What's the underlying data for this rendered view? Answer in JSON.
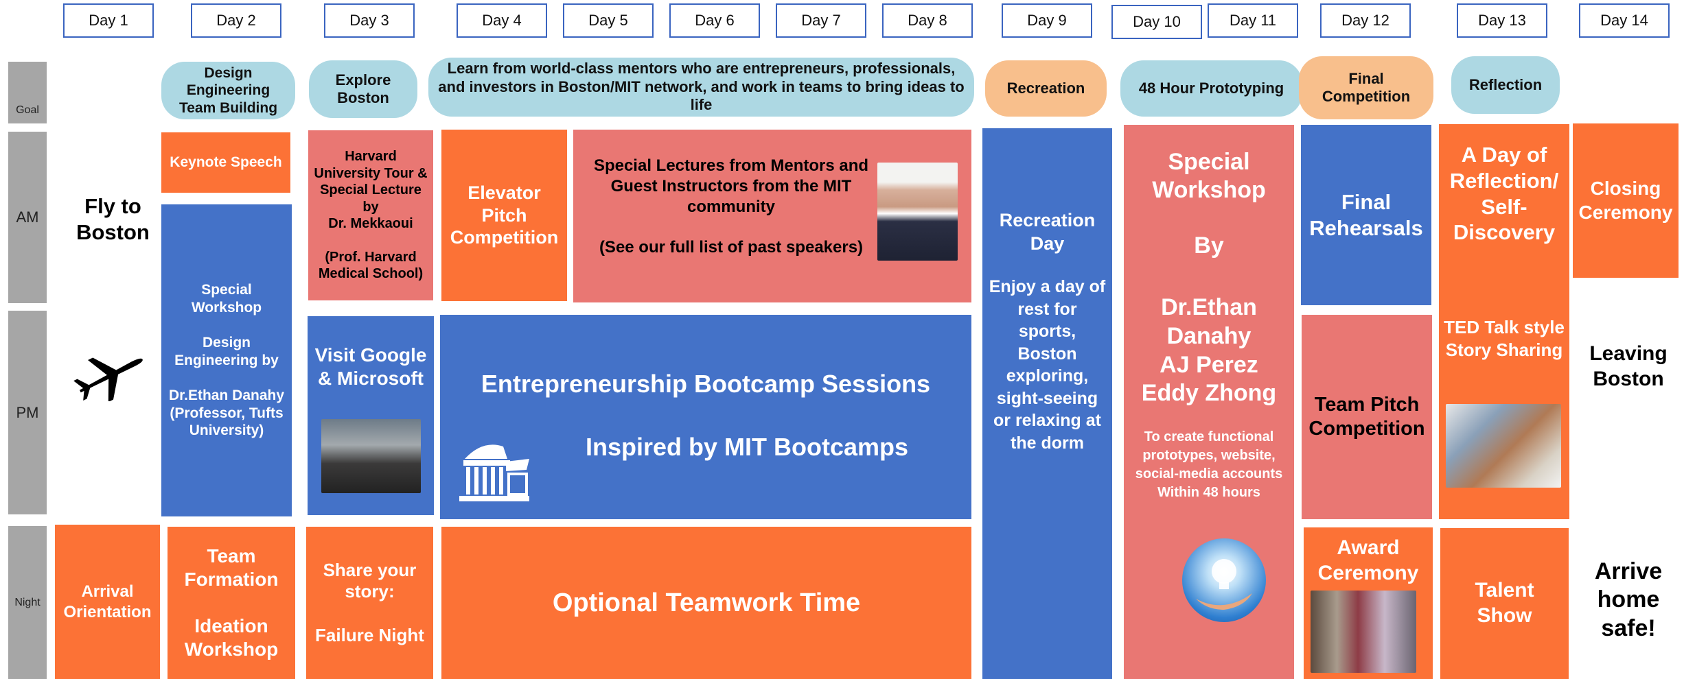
{
  "days": [
    "Day 1",
    "Day 2",
    "Day 3",
    "Day 4",
    "Day 5",
    "Day 6",
    "Day 7",
    "Day 8",
    "Day 9",
    "Day 10",
    "Day 11",
    "Day 12",
    "Day 13",
    "Day 14"
  ],
  "row_labels": {
    "goal": "Goal",
    "am": "AM",
    "pm": "PM",
    "night": "Night"
  },
  "goals": {
    "design_team": "Design Engineering Team Building",
    "explore": "Explore Boston",
    "learn": "Learn from world-class mentors who are entrepreneurs, professionals, and investors in Boston/MIT network, and work in teams to bring ideas to life",
    "recreation": "Recreation",
    "prototyping": "48 Hour Prototyping",
    "final": "Final Competition",
    "reflection": "Reflection"
  },
  "blocks": {
    "fly_to_boston": "Fly to Boston",
    "keynote": "Keynote Speech",
    "special_workshop_design": "Special Workshop\n\nDesign Engineering by\n\nDr.Ethan Danahy (Professor, Tufts University)",
    "harvard_tour": "Harvard University Tour &\nSpecial Lecture by\nDr. Mekkaoui\n\n(Prof. Harvard Medical School)",
    "elevator_pitch": "Elevator Pitch Competition",
    "special_lectures": "Special Lectures from Mentors and Guest Instructors from the MIT community",
    "past_speakers": "(See our full list of past speakers)",
    "visit_google": "Visit Google & Microsoft",
    "bootcamp_title": "Entrepreneurship Bootcamp Sessions",
    "bootcamp_sub": "Inspired by MIT Bootcamps",
    "recreation_day": "Recreation Day",
    "recreation_desc": "Enjoy a day of rest for sports, Boston exploring, sight-seeing or relaxing at the dorm",
    "workshop_title": "Special Workshop\n\nBy",
    "workshop_names": "Dr.Ethan Danahy\nAJ Perez\nEddy Zhong",
    "workshop_desc": "To create functional prototypes, website, social-media accounts\nWithin 48 hours",
    "final_rehearsals": "Final Rehearsals",
    "team_pitch": "Team Pitch Competition",
    "award_ceremony": "Award Ceremony",
    "day_of_reflection": "A Day of Reflection/ Self-Discovery",
    "ted_talk": "TED Talk style Story Sharing",
    "closing_ceremony": "Closing Ceremony",
    "leaving_boston": "Leaving Boston",
    "arrival": "Arrival Orientation",
    "team_formation": "Team Formation\n\nIdeation Workshop",
    "failure_night": "Share your story:\n\nFailure Night",
    "optional_teamwork": "Optional Teamwork Time",
    "talent_show": "Talent Show",
    "arrive_home": "Arrive home safe!"
  },
  "icons": {
    "airplane": "airplane-icon",
    "mit_building": "mit-building-icon",
    "lightbulb": "lightbulb-hand-icon"
  },
  "colors": {
    "orange": "#fc7236",
    "blue": "#4472c8",
    "salmon": "#e97773",
    "goal_blue": "#add8e3",
    "goal_peach": "#f8bf8c",
    "row_gray": "#a6a6a6"
  }
}
